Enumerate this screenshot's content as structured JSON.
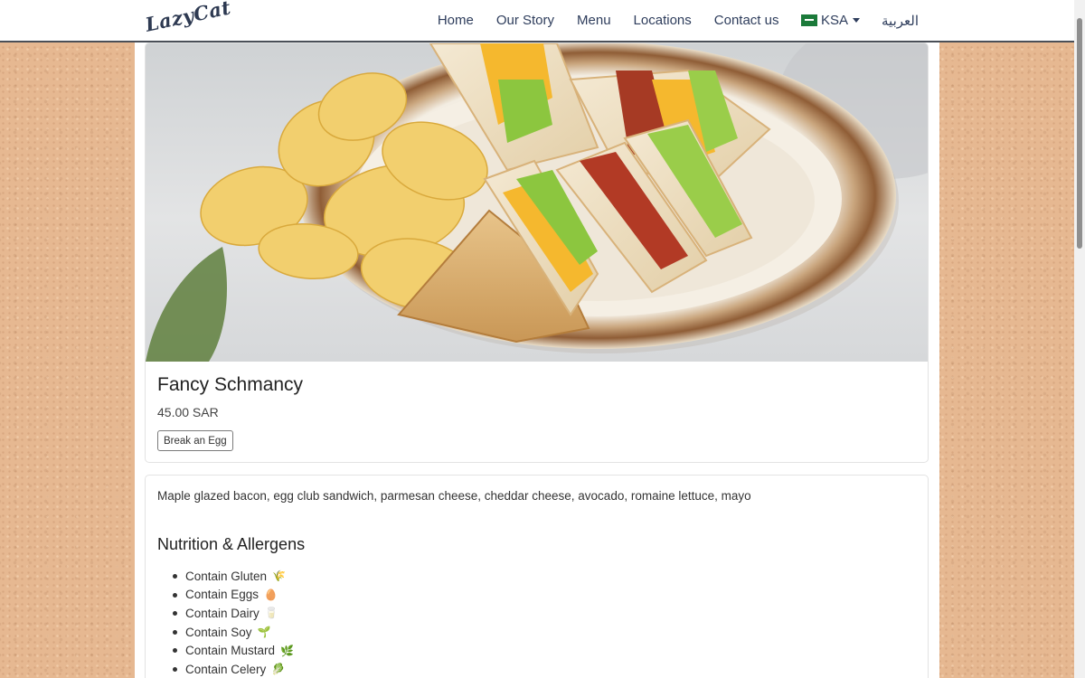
{
  "brand": {
    "logo_text": "LazyCat"
  },
  "nav": {
    "links": [
      "Home",
      "Our Story",
      "Menu",
      "Locations",
      "Contact us"
    ],
    "country": "KSA",
    "language": "العربية"
  },
  "product": {
    "title": "Fancy Schmancy",
    "price": "45.00 SAR",
    "variant_button": "Break an Egg",
    "image_alt": "Club sandwich with potato chips on a plate"
  },
  "description": "Maple glazed bacon, egg club sandwich, parmesan cheese, cheddar cheese, avocado, romaine lettuce, mayo",
  "nutrition": {
    "title": "Nutrition & Allergens",
    "items": [
      {
        "label": "Contain Gluten",
        "icon": "🌾"
      },
      {
        "label": "Contain Eggs",
        "icon": "🥚"
      },
      {
        "label": "Contain Dairy",
        "icon": "🥛"
      },
      {
        "label": "Contain Soy",
        "icon": "🌱"
      },
      {
        "label": "Contain Mustard",
        "icon": "🌿"
      },
      {
        "label": "Contain Celery",
        "icon": "🥬"
      }
    ]
  }
}
